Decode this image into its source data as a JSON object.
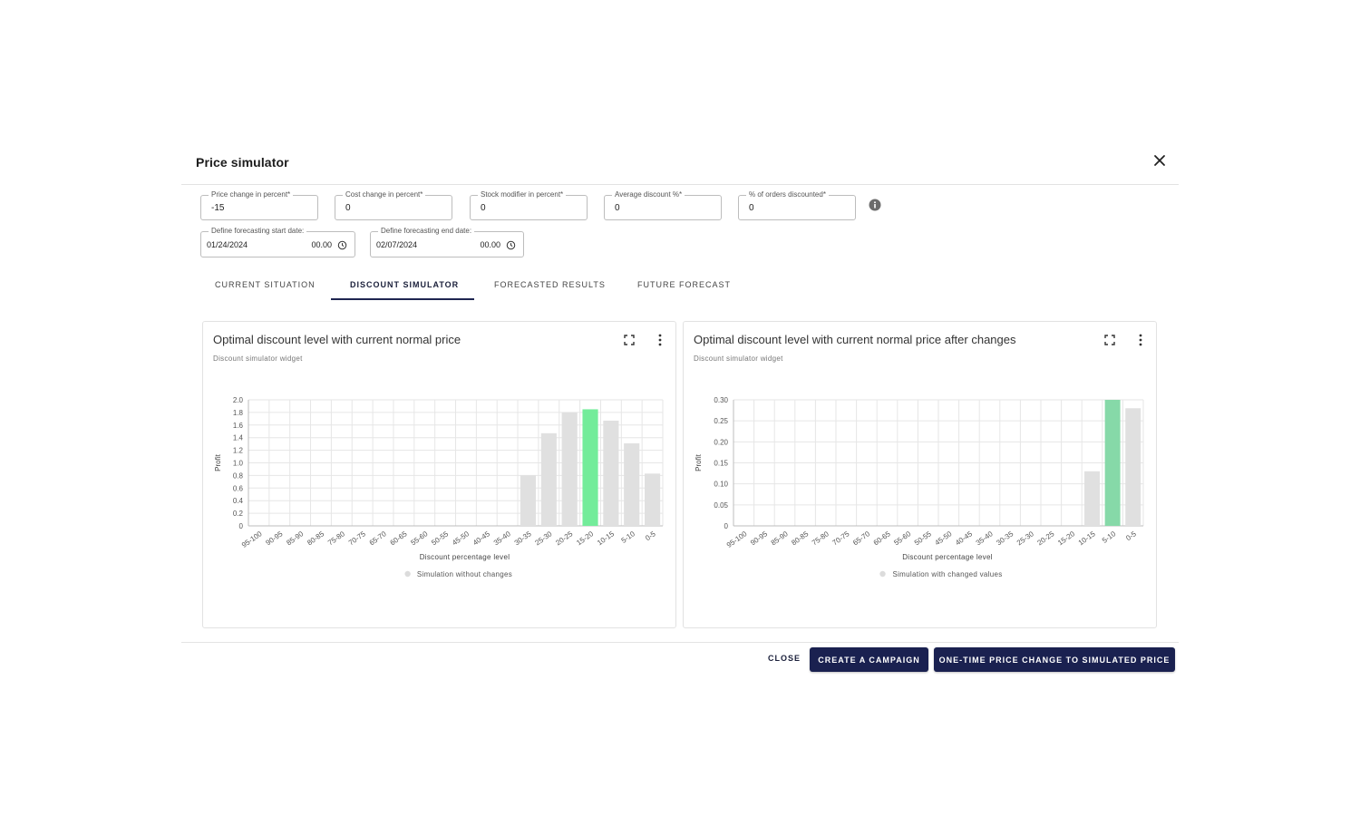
{
  "dialog": {
    "title": "Price simulator",
    "close_icon": "close-icon"
  },
  "fields": [
    {
      "label": "Price change in percent*",
      "value": "-15"
    },
    {
      "label": "Cost change in percent*",
      "value": "0"
    },
    {
      "label": "Stock modifier in percent*",
      "value": "0"
    },
    {
      "label": "Average discount %*",
      "value": "0"
    },
    {
      "label": "% of orders discounted*",
      "value": "0"
    }
  ],
  "info_icon": "info-icon",
  "dates": {
    "start": {
      "label": "Define forecasting start date:",
      "value": "01/24/2024",
      "time": "00.00"
    },
    "end": {
      "label": "Define forecasting end date:",
      "value": "02/07/2024",
      "time": "00.00"
    }
  },
  "tabs": [
    {
      "label": "CURRENT SITUATION",
      "active": false
    },
    {
      "label": "DISCOUNT SIMULATOR",
      "active": true
    },
    {
      "label": "FORECASTED RESULTS",
      "active": false
    },
    {
      "label": "FUTURE FORECAST",
      "active": false
    }
  ],
  "cards": [
    {
      "title": "Optimal discount level with current normal price",
      "subtitle": "Discount simulator widget"
    },
    {
      "title": "Optimal discount level with current normal price after changes",
      "subtitle": "Discount simulator widget"
    }
  ],
  "chart_data": [
    {
      "type": "bar",
      "categories": [
        "95-100",
        "90-95",
        "85-90",
        "80-85",
        "75-80",
        "70-75",
        "65-70",
        "60-65",
        "55-60",
        "50-55",
        "45-50",
        "40-45",
        "35-40",
        "30-35",
        "25-30",
        "20-25",
        "15-20",
        "10-15",
        "5-10",
        "0-5"
      ],
      "series": [
        {
          "name": "Simulation without changes",
          "values": [
            0,
            0,
            0,
            0,
            0,
            0,
            0,
            0,
            0,
            0,
            0,
            0,
            0,
            0.8,
            1.47,
            1.8,
            1.85,
            1.67,
            1.31,
            0.83
          ]
        }
      ],
      "highlight_index": 16,
      "bar_color": "#e0e0e0",
      "highlight_color": "#73ec9a",
      "xlabel": "Discount percentage level",
      "ylabel": "Profit",
      "ylim": [
        0,
        2.0
      ],
      "yticks": [
        "0",
        "0.2",
        "0.4",
        "0.6",
        "0.8",
        "1.0",
        "1.2",
        "1.4",
        "1.6",
        "1.8",
        "2.0"
      ],
      "grid": true,
      "legend": "bottom"
    },
    {
      "type": "bar",
      "categories": [
        "95-100",
        "90-95",
        "85-90",
        "80-85",
        "75-80",
        "70-75",
        "65-70",
        "60-65",
        "55-60",
        "50-55",
        "45-50",
        "40-45",
        "35-40",
        "30-35",
        "25-30",
        "20-25",
        "15-20",
        "10-15",
        "5-10",
        "0-5"
      ],
      "series": [
        {
          "name": "Simulation with changed values",
          "values": [
            0,
            0,
            0,
            0,
            0,
            0,
            0,
            0,
            0,
            0,
            0,
            0,
            0,
            0,
            0,
            0,
            0,
            0.13,
            0.3,
            0.28
          ]
        }
      ],
      "highlight_index": 18,
      "bar_color": "#e0e0e0",
      "highlight_color": "#86d9a8",
      "xlabel": "Discount percentage level",
      "ylabel": "Profit",
      "ylim": [
        0,
        0.3
      ],
      "yticks": [
        "0",
        "0.05",
        "0.10",
        "0.15",
        "0.20",
        "0.25",
        "0.30"
      ],
      "grid": true,
      "legend": "bottom"
    }
  ],
  "actions": {
    "close": "CLOSE",
    "create_campaign": "CREATE A CAMPAIGN",
    "one_time": "ONE-TIME PRICE CHANGE TO SIMULATED PRICE"
  }
}
